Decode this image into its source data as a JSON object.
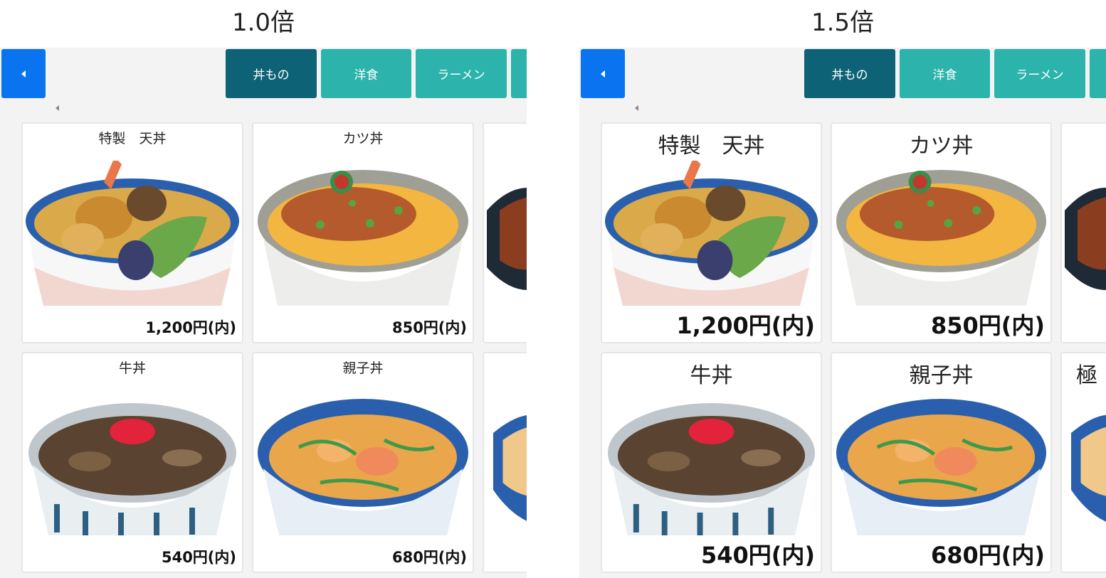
{
  "panels": [
    {
      "zoom_label": "1.0倍",
      "tabs": [
        {
          "label": "丼もの",
          "active": true
        },
        {
          "label": "洋食",
          "active": false
        },
        {
          "label": "ラーメン",
          "active": false
        }
      ],
      "items": [
        {
          "name": "特製　天丼",
          "price": "1,200円(内)",
          "image": "tendon-bowl-image"
        },
        {
          "name": "カツ丼",
          "price": "850円(内)",
          "image": "katsudon-bowl-image"
        },
        {
          "name": "牛丼",
          "price": "540円(内)",
          "image": "gyudon-bowl-image"
        },
        {
          "name": "親子丼",
          "price": "680円(内)",
          "image": "oyakodon-bowl-image"
        }
      ]
    },
    {
      "zoom_label": "1.5倍",
      "tabs": [
        {
          "label": "丼もの",
          "active": true
        },
        {
          "label": "洋食",
          "active": false
        },
        {
          "label": "ラーメン",
          "active": false
        }
      ],
      "items": [
        {
          "name": "特製　天丼",
          "price": "1,200円(内)",
          "image": "tendon-bowl-image"
        },
        {
          "name": "カツ丼",
          "price": "850円(内)",
          "image": "katsudon-bowl-image"
        },
        {
          "name": "牛丼",
          "price": "540円(内)",
          "image": "gyudon-bowl-image"
        },
        {
          "name": "親子丼",
          "price": "680円(内)",
          "image": "oyakodon-bowl-image"
        }
      ],
      "partial_item_name": "極"
    }
  ],
  "colors": {
    "back_button": "#0a74f0",
    "tab_active": "#0e6276",
    "tab_inactive": "#2cb3ab",
    "screen_bg": "#f3f3f3"
  },
  "icons": {
    "back": "caret-left-icon",
    "scroll": "scroll-left-arrow-icon"
  }
}
